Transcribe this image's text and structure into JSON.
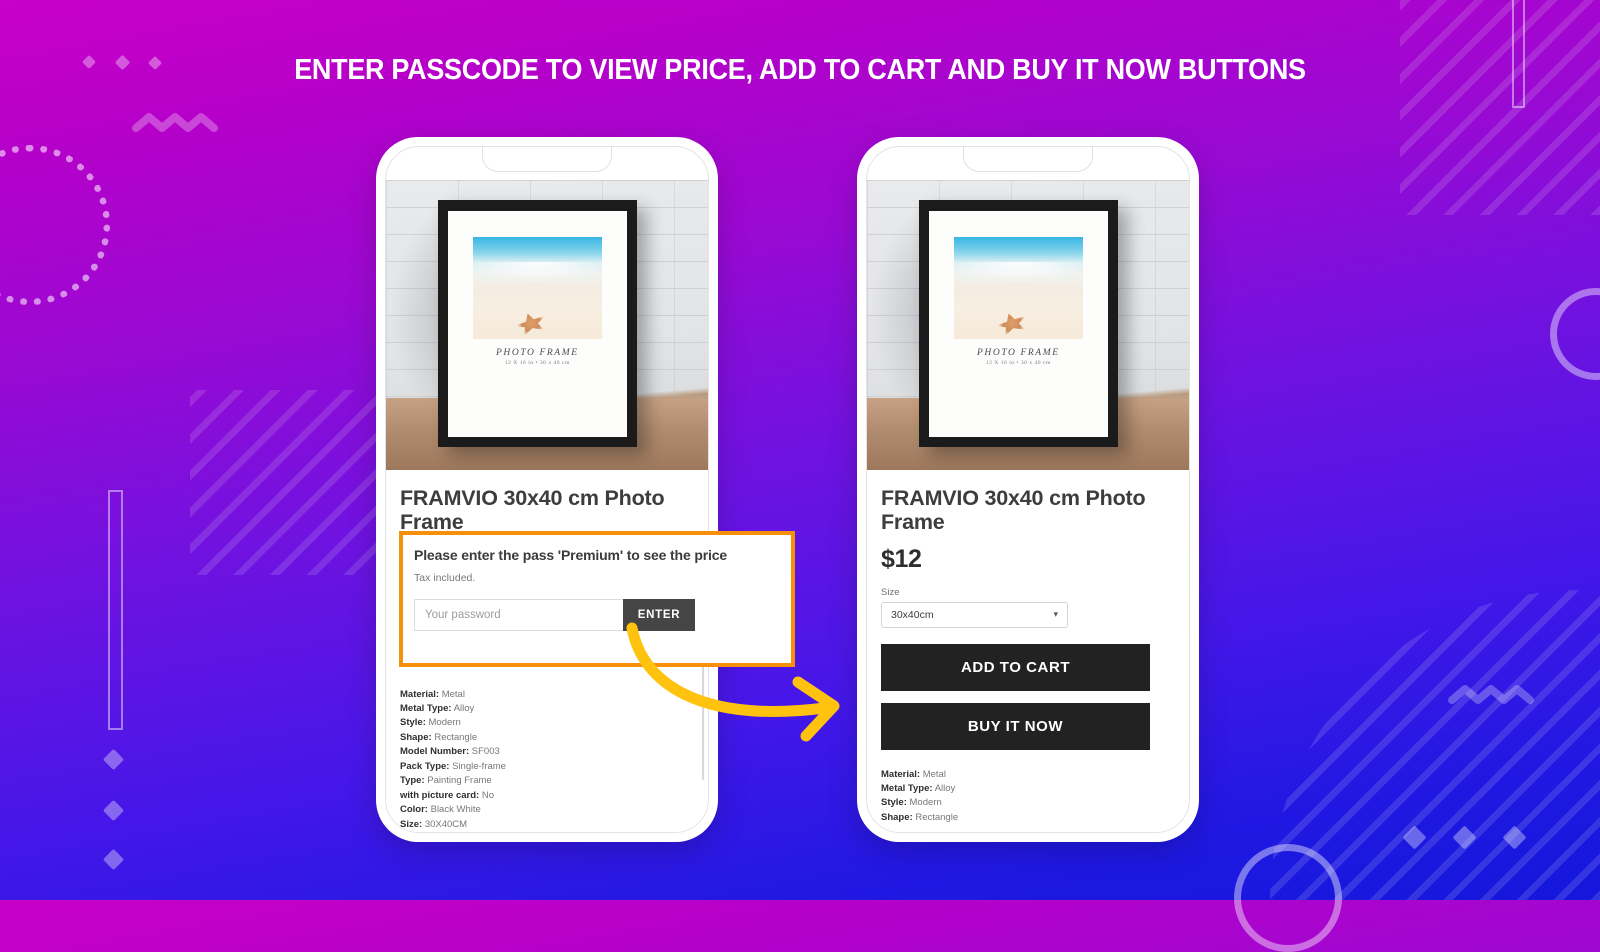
{
  "headline": "ENTER PASSCODE TO VIEW PRICE, ADD TO CART AND BUY IT NOW BUTTONS",
  "colors": {
    "bg_top": "#C800C8",
    "bg_bottom": "#1417DC",
    "highlight_orange": "#F79009",
    "arrow_yellow": "#FFC20E",
    "cta_dark": "#222222",
    "enter_button": "#454545"
  },
  "product": {
    "title": "FRAMVIO 30x40 cm Photo Frame",
    "price": "$12",
    "frame_art_caption": "PHOTO FRAME",
    "frame_art_dimensions": "12 X 16 in • 30 x 40 cm"
  },
  "left_phone": {
    "pass_prompt": "Please enter the pass 'Premium' to see the price",
    "tax_note": "Tax included.",
    "password_placeholder": "Your password",
    "password_value": "",
    "enter_label": "ENTER",
    "specs": [
      {
        "key": "Material:",
        "value": "Metal"
      },
      {
        "key": "Metal Type:",
        "value": "Alloy"
      },
      {
        "key": "Style:",
        "value": "Modern"
      },
      {
        "key": "Shape:",
        "value": "Rectangle"
      },
      {
        "key": "Model Number:",
        "value": "SF003"
      },
      {
        "key": "Pack Type:",
        "value": "Single-frame"
      },
      {
        "key": "Type:",
        "value": "Painting Frame"
      },
      {
        "key": "with picture card:",
        "value": "No"
      },
      {
        "key": "Color:",
        "value": "Black White"
      },
      {
        "key": "Size:",
        "value": "30X40CM"
      }
    ]
  },
  "right_phone": {
    "size_label": "Size",
    "size_value": "30x40cm",
    "size_options": [
      "30x40cm"
    ],
    "add_to_cart_label": "ADD TO CART",
    "buy_it_now_label": "BUY IT NOW",
    "specs": [
      {
        "key": "Material:",
        "value": "Metal"
      },
      {
        "key": "Metal Type:",
        "value": "Alloy"
      },
      {
        "key": "Style:",
        "value": "Modern"
      },
      {
        "key": "Shape:",
        "value": "Rectangle"
      }
    ]
  }
}
